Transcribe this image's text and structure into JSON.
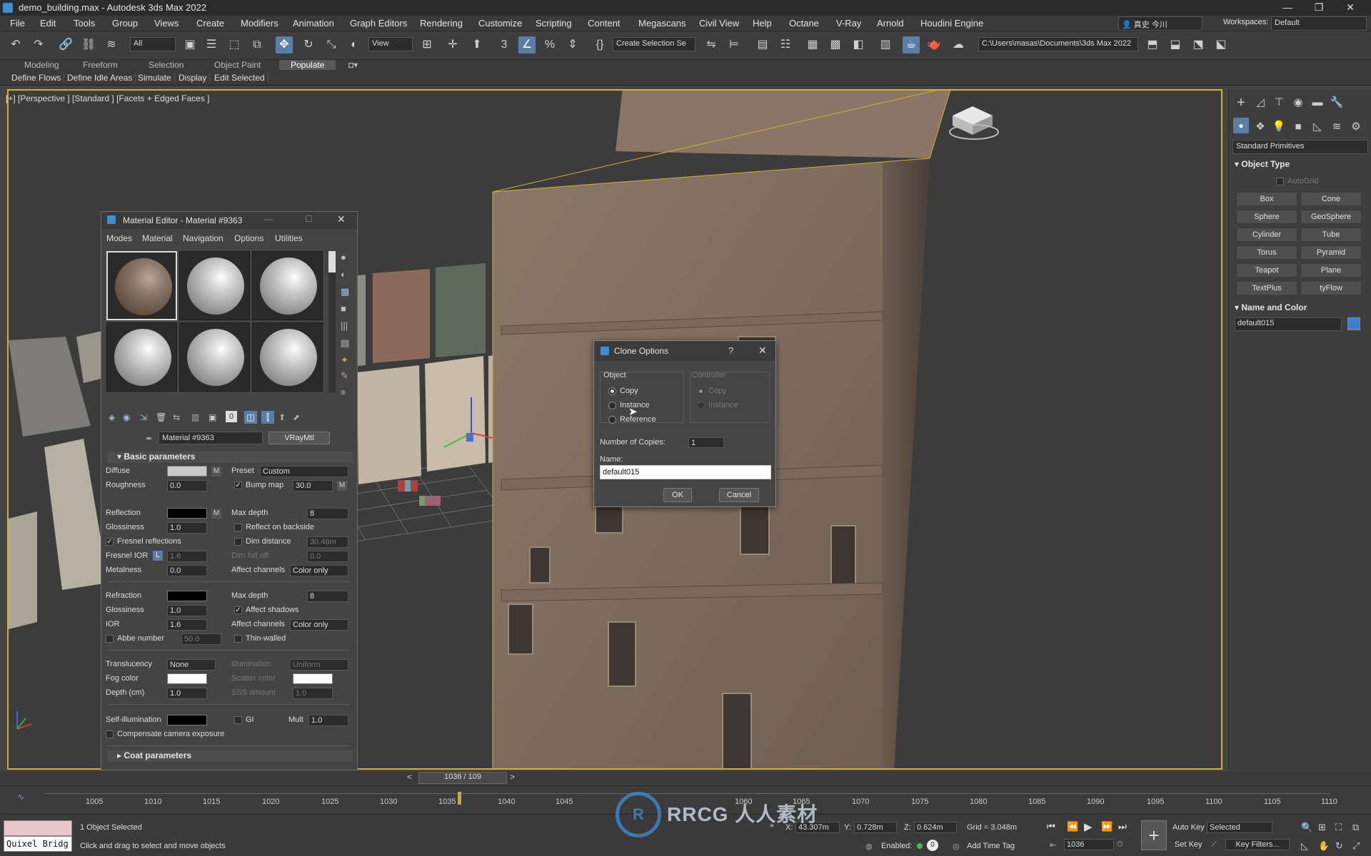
{
  "app": {
    "title": "demo_building.max - Autodesk 3ds Max 2022"
  },
  "menu": [
    "File",
    "Edit",
    "Tools",
    "Group",
    "Views",
    "Create",
    "Modifiers",
    "Animation",
    "Graph Editors",
    "Rendering",
    "Customize",
    "Scripting",
    "Content",
    "Megascans",
    "Civil View",
    "Help",
    "Octane",
    "V-Ray",
    "Arnold",
    "Houdini Engine"
  ],
  "user": {
    "name": "真史 今川"
  },
  "workspace": {
    "label": "Workspaces:",
    "value": "Default"
  },
  "toolbar": {
    "filter": "All",
    "ref_coord": "View",
    "selection_set": "Create Selection Se",
    "path": "C:\\Users\\masas\\Documents\\3ds Max 2022"
  },
  "ribbon": {
    "tabs": [
      "Modeling",
      "Freeform",
      "Selection",
      "Object Paint",
      "Populate"
    ],
    "active": "Populate",
    "buttons": [
      "Define Flows",
      "Define Idle Areas",
      "Simulate",
      "Display",
      "Edit Selected"
    ]
  },
  "viewport": {
    "label": "[+] [Perspective ] [Standard ] [Facets + Edged Faces ]"
  },
  "command_panel": {
    "category": "Standard Primitives",
    "object_type_title": "Object Type",
    "autogrid": "AutoGrid",
    "buttons": [
      "Box",
      "Cone",
      "Sphere",
      "GeoSphere",
      "Cylinder",
      "Tube",
      "Torus",
      "Pyramid",
      "Teapot",
      "Plane",
      "TextPlus",
      "tyFlow"
    ],
    "name_color_title": "Name and Color",
    "name": "default015",
    "color": "#3f7fd0"
  },
  "material_editor": {
    "title": "Material Editor - Material #9363",
    "menus": [
      "Modes",
      "Material",
      "Navigation",
      "Options",
      "Utilities"
    ],
    "material_name": "Material #9363",
    "material_type": "VRayMtl",
    "basic_title": "Basic parameters",
    "diffuse": "Diffuse",
    "m": "M",
    "preset": "Preset",
    "preset_val": "Custom",
    "roughness": "Roughness",
    "roughness_val": "0.0",
    "bump_map": "Bump map",
    "bump_val": "30.0",
    "reflection": "Reflection",
    "max_depth": "Max depth",
    "refl_depth": "8",
    "glossiness": "Glossiness",
    "gloss_val": "1.0",
    "reflect_backside": "Reflect on backside",
    "dim_distance": "Dim distance",
    "dim_dist_val": "30.48m",
    "fresnel_refl": "Fresnel reflections",
    "fresnel_ior": "Fresnel IOR",
    "L": "L",
    "fresnel_val": "1.6",
    "dim_falloff": "Dim fall off",
    "dim_falloff_val": "0.0",
    "metalness": "Metalness",
    "metal_val": "0.0",
    "affect_channels": "Affect channels",
    "color_only": "Color only",
    "refraction": "Refraction",
    "refr_depth": "8",
    "refr_gloss": "Glossiness",
    "refr_gloss_val": "1.0",
    "affect_shadows": "Affect shadows",
    "ior": "IOR",
    "ior_val": "1.6",
    "abbe": "Abbe number",
    "abbe_val": "50.0",
    "thin_walled": "Thin-walled",
    "translucency": "Translucency",
    "transl_val": "None",
    "illumination": "Illumination",
    "illum_val": "Uniform",
    "fog_color": "Fog color",
    "scatter_color": "Scatter color",
    "depth": "Depth (cm)",
    "depth_val": "1.0",
    "sss_amount": "SSS amount",
    "sss_val": "1.0",
    "self_illum": "Self-illumination",
    "gi": "GI",
    "mult": "Mult",
    "mult_val": "1.0",
    "comp_cam": "Compensate camera exposure",
    "coat_title": "Coat parameters"
  },
  "clone_dialog": {
    "title": "Clone Options",
    "help": "?",
    "object_group": "Object",
    "controller_group": "Controller",
    "options": [
      "Copy",
      "Instance",
      "Reference"
    ],
    "controller_options": [
      "Copy",
      "Instance"
    ],
    "selected": "Copy",
    "copies_label": "Number of Copies:",
    "copies": "1",
    "name_label": "Name:",
    "name": "default015",
    "ok": "OK",
    "cancel": "Cancel"
  },
  "timeline": {
    "frame": "1036 / 109",
    "ticks": [
      "1005",
      "1010",
      "1015",
      "1020",
      "1025",
      "1030",
      "1035",
      "1040",
      "1045",
      "1060",
      "1065",
      "1070",
      "1075",
      "1080",
      "1085",
      "1090",
      "1095",
      "1100",
      "1105",
      "1110"
    ]
  },
  "status": {
    "script_listener": "Quixel Bridg",
    "selected": "1 Object Selected",
    "prompt": "Click and drag to select and move objects",
    "x": "43.307m",
    "y": "0.728m",
    "z": "0.624m",
    "grid": "Grid = 3.048m",
    "enabled": "Enabled:",
    "enabled_val": "0",
    "add_time_tag": "Add Time Tag",
    "auto_key": "Auto Key",
    "set_key": "Set Key",
    "key_mode": "Selected",
    "key_filters": "Key Filters...",
    "current_frame": "1036"
  },
  "watermark": "RRCG 人人素材"
}
